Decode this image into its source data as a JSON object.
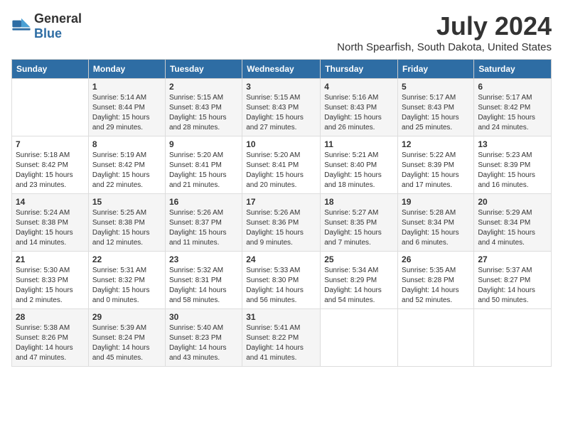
{
  "logo": {
    "general": "General",
    "blue": "Blue"
  },
  "title": "July 2024",
  "subtitle": "North Spearfish, South Dakota, United States",
  "days_of_week": [
    "Sunday",
    "Monday",
    "Tuesday",
    "Wednesday",
    "Thursday",
    "Friday",
    "Saturday"
  ],
  "weeks": [
    [
      {
        "day": "",
        "info": ""
      },
      {
        "day": "1",
        "info": "Sunrise: 5:14 AM\nSunset: 8:44 PM\nDaylight: 15 hours\nand 29 minutes."
      },
      {
        "day": "2",
        "info": "Sunrise: 5:15 AM\nSunset: 8:43 PM\nDaylight: 15 hours\nand 28 minutes."
      },
      {
        "day": "3",
        "info": "Sunrise: 5:15 AM\nSunset: 8:43 PM\nDaylight: 15 hours\nand 27 minutes."
      },
      {
        "day": "4",
        "info": "Sunrise: 5:16 AM\nSunset: 8:43 PM\nDaylight: 15 hours\nand 26 minutes."
      },
      {
        "day": "5",
        "info": "Sunrise: 5:17 AM\nSunset: 8:43 PM\nDaylight: 15 hours\nand 25 minutes."
      },
      {
        "day": "6",
        "info": "Sunrise: 5:17 AM\nSunset: 8:42 PM\nDaylight: 15 hours\nand 24 minutes."
      }
    ],
    [
      {
        "day": "7",
        "info": "Sunrise: 5:18 AM\nSunset: 8:42 PM\nDaylight: 15 hours\nand 23 minutes."
      },
      {
        "day": "8",
        "info": "Sunrise: 5:19 AM\nSunset: 8:42 PM\nDaylight: 15 hours\nand 22 minutes."
      },
      {
        "day": "9",
        "info": "Sunrise: 5:20 AM\nSunset: 8:41 PM\nDaylight: 15 hours\nand 21 minutes."
      },
      {
        "day": "10",
        "info": "Sunrise: 5:20 AM\nSunset: 8:41 PM\nDaylight: 15 hours\nand 20 minutes."
      },
      {
        "day": "11",
        "info": "Sunrise: 5:21 AM\nSunset: 8:40 PM\nDaylight: 15 hours\nand 18 minutes."
      },
      {
        "day": "12",
        "info": "Sunrise: 5:22 AM\nSunset: 8:39 PM\nDaylight: 15 hours\nand 17 minutes."
      },
      {
        "day": "13",
        "info": "Sunrise: 5:23 AM\nSunset: 8:39 PM\nDaylight: 15 hours\nand 16 minutes."
      }
    ],
    [
      {
        "day": "14",
        "info": "Sunrise: 5:24 AM\nSunset: 8:38 PM\nDaylight: 15 hours\nand 14 minutes."
      },
      {
        "day": "15",
        "info": "Sunrise: 5:25 AM\nSunset: 8:38 PM\nDaylight: 15 hours\nand 12 minutes."
      },
      {
        "day": "16",
        "info": "Sunrise: 5:26 AM\nSunset: 8:37 PM\nDaylight: 15 hours\nand 11 minutes."
      },
      {
        "day": "17",
        "info": "Sunrise: 5:26 AM\nSunset: 8:36 PM\nDaylight: 15 hours\nand 9 minutes."
      },
      {
        "day": "18",
        "info": "Sunrise: 5:27 AM\nSunset: 8:35 PM\nDaylight: 15 hours\nand 7 minutes."
      },
      {
        "day": "19",
        "info": "Sunrise: 5:28 AM\nSunset: 8:34 PM\nDaylight: 15 hours\nand 6 minutes."
      },
      {
        "day": "20",
        "info": "Sunrise: 5:29 AM\nSunset: 8:34 PM\nDaylight: 15 hours\nand 4 minutes."
      }
    ],
    [
      {
        "day": "21",
        "info": "Sunrise: 5:30 AM\nSunset: 8:33 PM\nDaylight: 15 hours\nand 2 minutes."
      },
      {
        "day": "22",
        "info": "Sunrise: 5:31 AM\nSunset: 8:32 PM\nDaylight: 15 hours\nand 0 minutes."
      },
      {
        "day": "23",
        "info": "Sunrise: 5:32 AM\nSunset: 8:31 PM\nDaylight: 14 hours\nand 58 minutes."
      },
      {
        "day": "24",
        "info": "Sunrise: 5:33 AM\nSunset: 8:30 PM\nDaylight: 14 hours\nand 56 minutes."
      },
      {
        "day": "25",
        "info": "Sunrise: 5:34 AM\nSunset: 8:29 PM\nDaylight: 14 hours\nand 54 minutes."
      },
      {
        "day": "26",
        "info": "Sunrise: 5:35 AM\nSunset: 8:28 PM\nDaylight: 14 hours\nand 52 minutes."
      },
      {
        "day": "27",
        "info": "Sunrise: 5:37 AM\nSunset: 8:27 PM\nDaylight: 14 hours\nand 50 minutes."
      }
    ],
    [
      {
        "day": "28",
        "info": "Sunrise: 5:38 AM\nSunset: 8:26 PM\nDaylight: 14 hours\nand 47 minutes."
      },
      {
        "day": "29",
        "info": "Sunrise: 5:39 AM\nSunset: 8:24 PM\nDaylight: 14 hours\nand 45 minutes."
      },
      {
        "day": "30",
        "info": "Sunrise: 5:40 AM\nSunset: 8:23 PM\nDaylight: 14 hours\nand 43 minutes."
      },
      {
        "day": "31",
        "info": "Sunrise: 5:41 AM\nSunset: 8:22 PM\nDaylight: 14 hours\nand 41 minutes."
      },
      {
        "day": "",
        "info": ""
      },
      {
        "day": "",
        "info": ""
      },
      {
        "day": "",
        "info": ""
      }
    ]
  ]
}
